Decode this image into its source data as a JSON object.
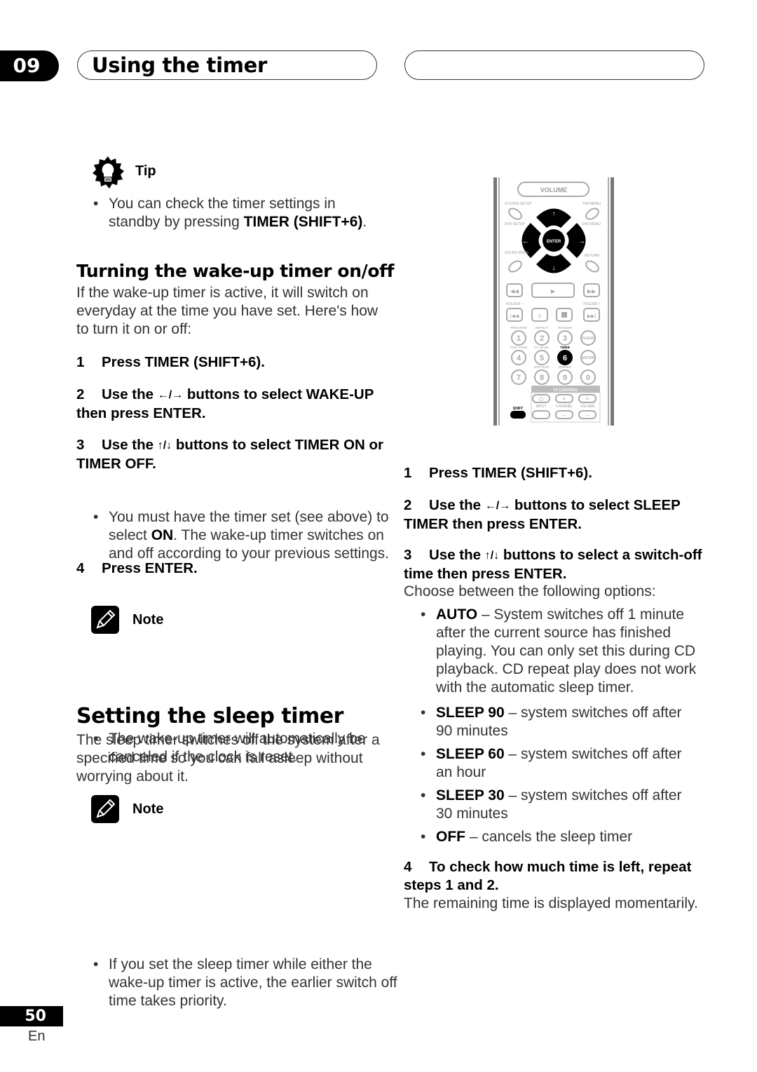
{
  "header": {
    "chapter_number": "09",
    "chapter_title": "Using the timer"
  },
  "tip": {
    "label": "Tip",
    "text_before": "You can check the timer settings in standby by pressing ",
    "text_bold": "TIMER (SHIFT+6)",
    "text_after": "."
  },
  "wakeup_section": {
    "heading": "Turning the wake-up timer on/off",
    "intro": "If the wake-up timer is active, it will switch on everyday at the time you have set. Here's how to turn it on or off:",
    "steps": [
      {
        "num": "1",
        "text": "Press TIMER (SHIFT+6)."
      },
      {
        "num": "2",
        "text_before": "Use the ",
        "arrows": "←/→",
        "text_after": " buttons to select WAKE-UP then press ENTER."
      },
      {
        "num": "3",
        "text_before": "Use the ",
        "arrows": "↑/↓",
        "text_after": " buttons to select TIMER ON or TIMER OFF."
      },
      {
        "num": "4",
        "text": "Press ENTER."
      }
    ],
    "step3_bullet": {
      "before": "You must have the timer set (see above) to select ",
      "bold": "ON",
      "after": ". The wake-up timer switches on and off according to your previous settings."
    },
    "note": {
      "label": "Note",
      "text": "The wake-up timer will automatically be canceled if the clock is reset."
    }
  },
  "sleep_section": {
    "heading": "Setting the sleep timer",
    "intro": "The sleep timer switches off the system after a specified time so you can fall asleep without worrying about it.",
    "note": {
      "label": "Note",
      "text": "If you set the sleep timer while either the wake-up timer is active, the earlier switch off time takes priority."
    },
    "steps": [
      {
        "num": "1",
        "text": "Press TIMER (SHIFT+6)."
      },
      {
        "num": "2",
        "text_before": "Use the ",
        "arrows": "←/→",
        "text_after": " buttons to select SLEEP TIMER then press ENTER."
      },
      {
        "num": "3",
        "text_before": "Use the ",
        "arrows": "↑/↓",
        "text_after": " buttons to select a switch-off time then press ENTER."
      },
      {
        "num": "4",
        "text": "To check how much time is left, repeat steps 1 and 2."
      }
    ],
    "step3_intro": "Choose between the following options:",
    "options": [
      {
        "name": "AUTO",
        "desc": " – System switches off 1 minute after the current source has finished playing. You can only set this during CD playback. CD repeat play does not work with the automatic sleep timer."
      },
      {
        "name": "SLEEP 90",
        "desc": " – system switches off after 90 minutes"
      },
      {
        "name": "SLEEP 60",
        "desc": " – system switches off after an hour"
      },
      {
        "name": "SLEEP 30",
        "desc": " – system switches off after 30 minutes"
      },
      {
        "name": "OFF",
        "desc": " – cancels the sleep timer"
      }
    ],
    "step4_detail": "The remaining time is displayed momentarily."
  },
  "remote": {
    "volume": "VOLUME",
    "system_setup": "SYSTEM SETUP",
    "top_menu": "TOP MENU",
    "dvd_setup": "DVD SETUP",
    "dvd_menu": "DVD MENU",
    "enter": "ENTER",
    "sound_mode": "SOUND MODE",
    "return": "RETURN",
    "folder_minus": "FOLDER –",
    "folder_plus": "FOLDER +",
    "program": "PROGRAM",
    "repeat": "REPEAT",
    "random": "RANDOM",
    "clear": "CLEAR",
    "test_tone": "TEST TONE",
    "ch_level": "CH LEVEL",
    "timer": "TIMER",
    "enter2": "ENTER",
    "dvd_disp": "DVD DISP",
    "dimmer": "DIMMER",
    "tv_control": "TV CONTROL",
    "input": "INPUT",
    "channel": "CHANNEL",
    "tv_volume": "VOLUME",
    "shift": "SHIFT",
    "digits": [
      "1",
      "2",
      "3",
      "4",
      "5",
      "6",
      "7",
      "8",
      "9",
      "0"
    ],
    "highlighted_key": "6"
  },
  "footer": {
    "page_number": "50",
    "language": "En"
  }
}
